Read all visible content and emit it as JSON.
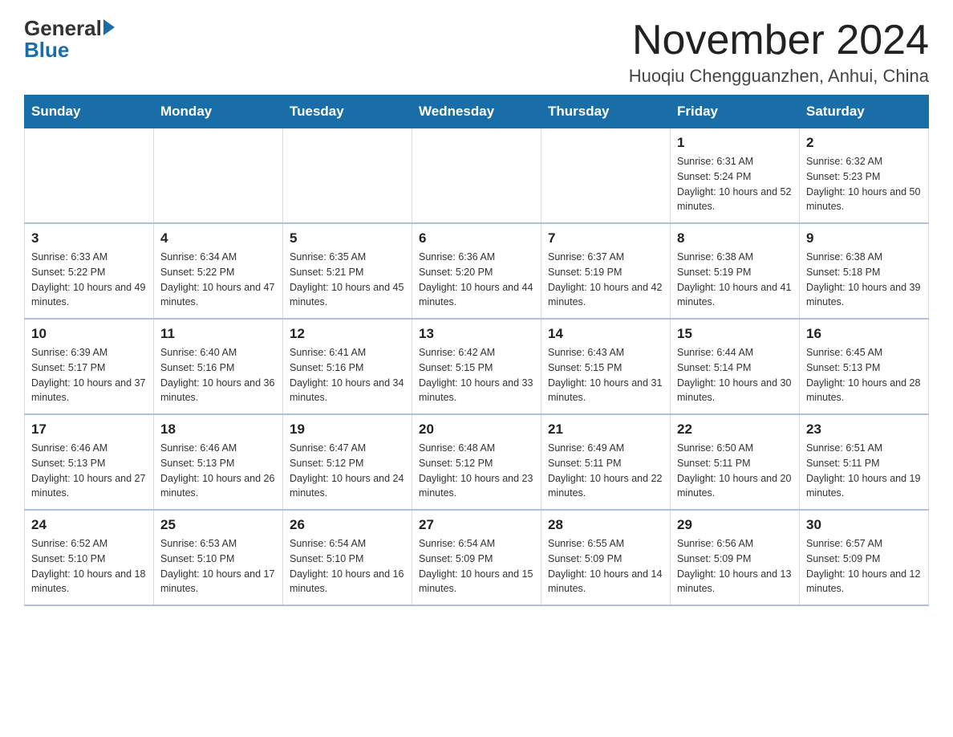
{
  "header": {
    "logo_general": "General",
    "logo_blue": "Blue",
    "month_title": "November 2024",
    "location": "Huoqiu Chengguanzhen, Anhui, China"
  },
  "days_of_week": [
    "Sunday",
    "Monday",
    "Tuesday",
    "Wednesday",
    "Thursday",
    "Friday",
    "Saturday"
  ],
  "weeks": [
    [
      {
        "day": "",
        "info": ""
      },
      {
        "day": "",
        "info": ""
      },
      {
        "day": "",
        "info": ""
      },
      {
        "day": "",
        "info": ""
      },
      {
        "day": "",
        "info": ""
      },
      {
        "day": "1",
        "info": "Sunrise: 6:31 AM\nSunset: 5:24 PM\nDaylight: 10 hours and 52 minutes."
      },
      {
        "day": "2",
        "info": "Sunrise: 6:32 AM\nSunset: 5:23 PM\nDaylight: 10 hours and 50 minutes."
      }
    ],
    [
      {
        "day": "3",
        "info": "Sunrise: 6:33 AM\nSunset: 5:22 PM\nDaylight: 10 hours and 49 minutes."
      },
      {
        "day": "4",
        "info": "Sunrise: 6:34 AM\nSunset: 5:22 PM\nDaylight: 10 hours and 47 minutes."
      },
      {
        "day": "5",
        "info": "Sunrise: 6:35 AM\nSunset: 5:21 PM\nDaylight: 10 hours and 45 minutes."
      },
      {
        "day": "6",
        "info": "Sunrise: 6:36 AM\nSunset: 5:20 PM\nDaylight: 10 hours and 44 minutes."
      },
      {
        "day": "7",
        "info": "Sunrise: 6:37 AM\nSunset: 5:19 PM\nDaylight: 10 hours and 42 minutes."
      },
      {
        "day": "8",
        "info": "Sunrise: 6:38 AM\nSunset: 5:19 PM\nDaylight: 10 hours and 41 minutes."
      },
      {
        "day": "9",
        "info": "Sunrise: 6:38 AM\nSunset: 5:18 PM\nDaylight: 10 hours and 39 minutes."
      }
    ],
    [
      {
        "day": "10",
        "info": "Sunrise: 6:39 AM\nSunset: 5:17 PM\nDaylight: 10 hours and 37 minutes."
      },
      {
        "day": "11",
        "info": "Sunrise: 6:40 AM\nSunset: 5:16 PM\nDaylight: 10 hours and 36 minutes."
      },
      {
        "day": "12",
        "info": "Sunrise: 6:41 AM\nSunset: 5:16 PM\nDaylight: 10 hours and 34 minutes."
      },
      {
        "day": "13",
        "info": "Sunrise: 6:42 AM\nSunset: 5:15 PM\nDaylight: 10 hours and 33 minutes."
      },
      {
        "day": "14",
        "info": "Sunrise: 6:43 AM\nSunset: 5:15 PM\nDaylight: 10 hours and 31 minutes."
      },
      {
        "day": "15",
        "info": "Sunrise: 6:44 AM\nSunset: 5:14 PM\nDaylight: 10 hours and 30 minutes."
      },
      {
        "day": "16",
        "info": "Sunrise: 6:45 AM\nSunset: 5:13 PM\nDaylight: 10 hours and 28 minutes."
      }
    ],
    [
      {
        "day": "17",
        "info": "Sunrise: 6:46 AM\nSunset: 5:13 PM\nDaylight: 10 hours and 27 minutes."
      },
      {
        "day": "18",
        "info": "Sunrise: 6:46 AM\nSunset: 5:13 PM\nDaylight: 10 hours and 26 minutes."
      },
      {
        "day": "19",
        "info": "Sunrise: 6:47 AM\nSunset: 5:12 PM\nDaylight: 10 hours and 24 minutes."
      },
      {
        "day": "20",
        "info": "Sunrise: 6:48 AM\nSunset: 5:12 PM\nDaylight: 10 hours and 23 minutes."
      },
      {
        "day": "21",
        "info": "Sunrise: 6:49 AM\nSunset: 5:11 PM\nDaylight: 10 hours and 22 minutes."
      },
      {
        "day": "22",
        "info": "Sunrise: 6:50 AM\nSunset: 5:11 PM\nDaylight: 10 hours and 20 minutes."
      },
      {
        "day": "23",
        "info": "Sunrise: 6:51 AM\nSunset: 5:11 PM\nDaylight: 10 hours and 19 minutes."
      }
    ],
    [
      {
        "day": "24",
        "info": "Sunrise: 6:52 AM\nSunset: 5:10 PM\nDaylight: 10 hours and 18 minutes."
      },
      {
        "day": "25",
        "info": "Sunrise: 6:53 AM\nSunset: 5:10 PM\nDaylight: 10 hours and 17 minutes."
      },
      {
        "day": "26",
        "info": "Sunrise: 6:54 AM\nSunset: 5:10 PM\nDaylight: 10 hours and 16 minutes."
      },
      {
        "day": "27",
        "info": "Sunrise: 6:54 AM\nSunset: 5:09 PM\nDaylight: 10 hours and 15 minutes."
      },
      {
        "day": "28",
        "info": "Sunrise: 6:55 AM\nSunset: 5:09 PM\nDaylight: 10 hours and 14 minutes."
      },
      {
        "day": "29",
        "info": "Sunrise: 6:56 AM\nSunset: 5:09 PM\nDaylight: 10 hours and 13 minutes."
      },
      {
        "day": "30",
        "info": "Sunrise: 6:57 AM\nSunset: 5:09 PM\nDaylight: 10 hours and 12 minutes."
      }
    ]
  ]
}
